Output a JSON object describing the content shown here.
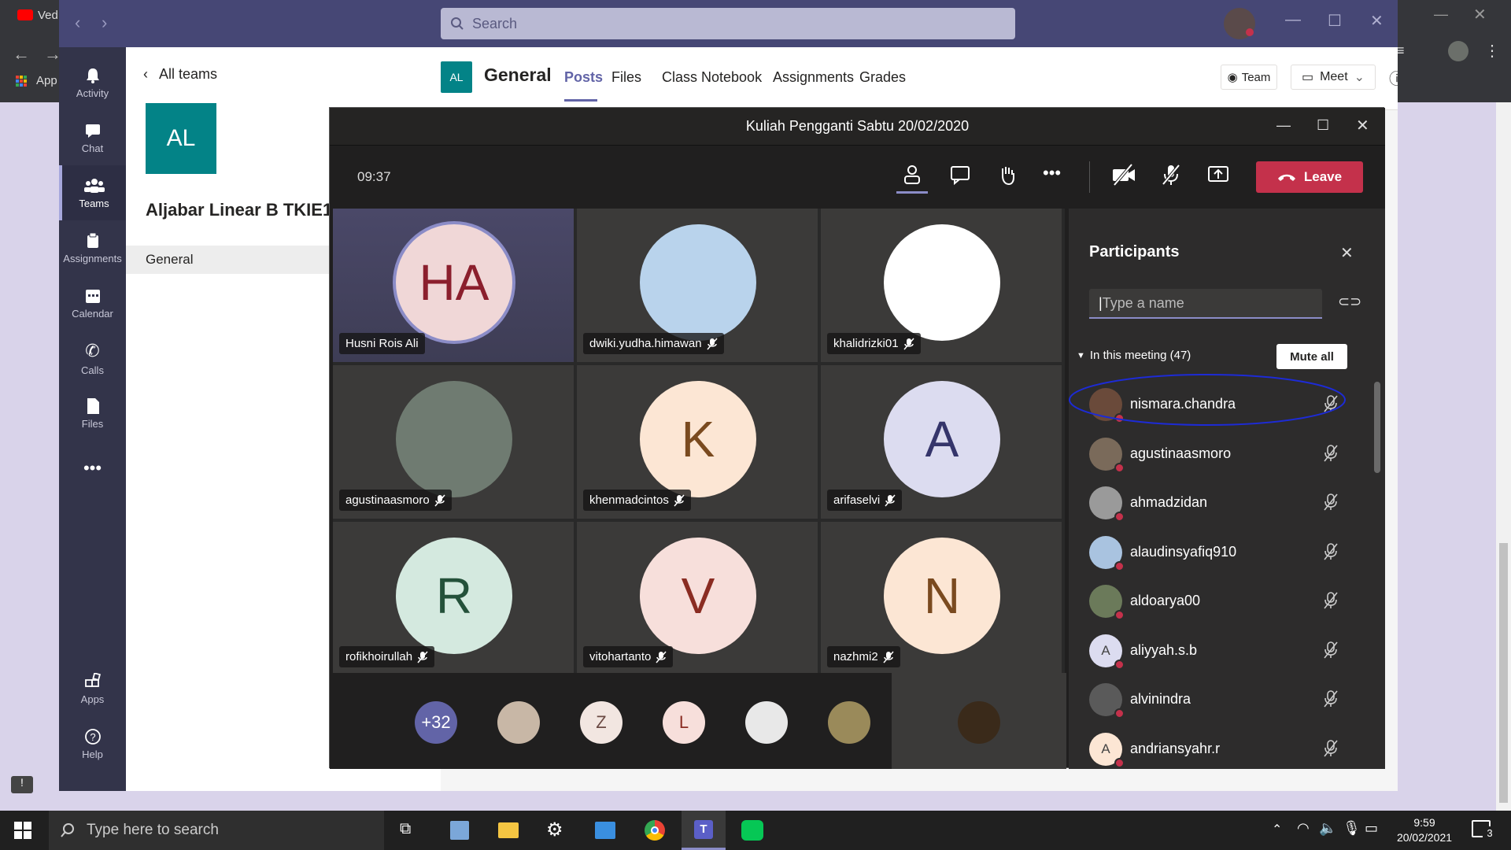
{
  "browser": {
    "tab_label": "Ved",
    "apps_label": "App"
  },
  "teams": {
    "search_placeholder": "Search",
    "rail": [
      {
        "label": "Activity",
        "icon": "bell-icon"
      },
      {
        "label": "Chat",
        "icon": "chat-icon"
      },
      {
        "label": "Teams",
        "icon": "teams-icon"
      },
      {
        "label": "Assignments",
        "icon": "assignments-icon"
      },
      {
        "label": "Calendar",
        "icon": "calendar-icon"
      },
      {
        "label": "Calls",
        "icon": "phone-icon"
      },
      {
        "label": "Files",
        "icon": "files-icon"
      },
      {
        "label": "Apps",
        "icon": "apps-icon"
      },
      {
        "label": "Help",
        "icon": "help-icon"
      }
    ],
    "all_teams": "All teams",
    "team_initials": "AL",
    "team_name": "Aljabar Linear B TKIE1",
    "channel": "General",
    "header": {
      "initials": "AL",
      "channel_title": "General",
      "tabs": [
        "Posts",
        "Files",
        "Class Notebook",
        "Assignments",
        "Grades"
      ],
      "team_button": "Team",
      "meet_button": "Meet"
    }
  },
  "meeting": {
    "title": "Kuliah Pengganti Sabtu 20/02/2020",
    "timer": "09:37",
    "leave_label": "Leave",
    "tiles": [
      {
        "name": "Husni Rois Ali",
        "initials": "HA",
        "bg": "#f0d7d7",
        "fg": "#8b1f2d",
        "speaking": true
      },
      {
        "name": "dwiki.yudha.himawan",
        "initials": "",
        "bg": "#b9d3ec",
        "fg": "#333"
      },
      {
        "name": "khalidrizki01",
        "initials": "",
        "bg": "#ffffff",
        "fg": "#333"
      },
      {
        "name": "agustinaasmoro",
        "initials": "",
        "bg": "#6f7b71",
        "fg": "#333"
      },
      {
        "name": "khenmadcintos",
        "initials": "K",
        "bg": "#fce6d4",
        "fg": "#7a4a1f"
      },
      {
        "name": "arifaselvi",
        "initials": "A",
        "bg": "#dcdcf0",
        "fg": "#35356b"
      },
      {
        "name": "rofikhoirullah",
        "initials": "R",
        "bg": "#d4e9df",
        "fg": "#24513a"
      },
      {
        "name": "vitohartanto",
        "initials": "V",
        "bg": "#f7dfdb",
        "fg": "#8a2c22"
      },
      {
        "name": "nazhmi2",
        "initials": "N",
        "bg": "#fce6d4",
        "fg": "#7a4a1f"
      }
    ],
    "overflow": [
      {
        "label": "+32",
        "bg": "#6264a7",
        "fg": "#ffffff"
      },
      {
        "label": "",
        "bg": "#c8b7a6",
        "fg": "#333"
      },
      {
        "label": "Z",
        "bg": "#f2e6e1",
        "fg": "#6b4a44"
      },
      {
        "label": "L",
        "bg": "#f7dfdb",
        "fg": "#8a2c22"
      },
      {
        "label": "",
        "bg": "#e8e8e8",
        "fg": "#333"
      },
      {
        "label": "",
        "bg": "#9a8a5a",
        "fg": "#333"
      }
    ],
    "participants": {
      "title": "Participants",
      "search_placeholder": "Type a name",
      "section": "In this meeting (47)",
      "mute_all": "Mute all",
      "list": [
        {
          "name": "nismara.chandra",
          "initials": "",
          "bg": "#6a4a3a"
        },
        {
          "name": "agustinaasmoro",
          "initials": "",
          "bg": "#7a6a5a"
        },
        {
          "name": "ahmadzidan",
          "initials": "",
          "bg": "#9a9a9a"
        },
        {
          "name": "alaudinsyafiq910",
          "initials": "",
          "bg": "#a9c3e0"
        },
        {
          "name": "aldoarya00",
          "initials": "",
          "bg": "#6b7a5a"
        },
        {
          "name": "aliyyah.s.b",
          "initials": "A",
          "bg": "#dcdcf0"
        },
        {
          "name": "alvinindra",
          "initials": "",
          "bg": "#5a5a5a"
        },
        {
          "name": "andriansyahr.r",
          "initials": "A",
          "bg": "#fce6d4"
        }
      ]
    }
  },
  "taskbar": {
    "search_placeholder": "Type here to search",
    "time": "9:59",
    "date": "20/02/2021",
    "notification_count": "3"
  },
  "colors": {
    "teams_purple": "#464775",
    "rail": "#33344a",
    "leave_red": "#c4314b",
    "accent": "#6264a7"
  }
}
